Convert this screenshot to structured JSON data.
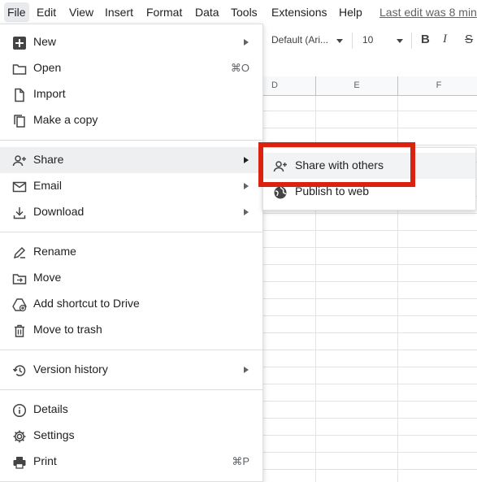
{
  "menubar": {
    "items": [
      "File",
      "Edit",
      "View",
      "Insert",
      "Format",
      "Data",
      "Tools",
      "Extensions",
      "Help"
    ],
    "last_edit": "Last edit was 8 min"
  },
  "toolbar": {
    "font": "Default (Ari...",
    "font_size": "10",
    "bold": "B",
    "italic": "I",
    "strike": "S"
  },
  "grid": {
    "columns": [
      "D",
      "E",
      "F"
    ]
  },
  "file_menu": {
    "new": {
      "label": "New",
      "icon": "plus-box-icon"
    },
    "open": {
      "label": "Open",
      "icon": "folder-icon",
      "shortcut": "⌘O"
    },
    "import": {
      "label": "Import",
      "icon": "file-icon"
    },
    "copy": {
      "label": "Make a copy",
      "icon": "copy-icon"
    },
    "share": {
      "label": "Share",
      "icon": "person-add-icon"
    },
    "email": {
      "label": "Email",
      "icon": "mail-icon"
    },
    "download": {
      "label": "Download",
      "icon": "download-icon"
    },
    "rename": {
      "label": "Rename",
      "icon": "rename-icon"
    },
    "move": {
      "label": "Move",
      "icon": "move-folder-icon"
    },
    "shortcut": {
      "label": "Add shortcut to Drive",
      "icon": "drive-shortcut-icon"
    },
    "trash": {
      "label": "Move to trash",
      "icon": "trash-icon"
    },
    "version": {
      "label": "Version history",
      "icon": "history-icon"
    },
    "details": {
      "label": "Details",
      "icon": "info-icon"
    },
    "settings": {
      "label": "Settings",
      "icon": "gear-icon"
    },
    "print": {
      "label": "Print",
      "icon": "printer-icon",
      "shortcut": "⌘P"
    }
  },
  "share_submenu": {
    "share_with_others": {
      "label": "Share with others",
      "icon": "person-add-icon"
    },
    "publish": {
      "label": "Publish to web",
      "icon": "globe-icon"
    }
  },
  "colors": {
    "highlight_box": "#d9220f",
    "hover": "#eeeff0"
  }
}
